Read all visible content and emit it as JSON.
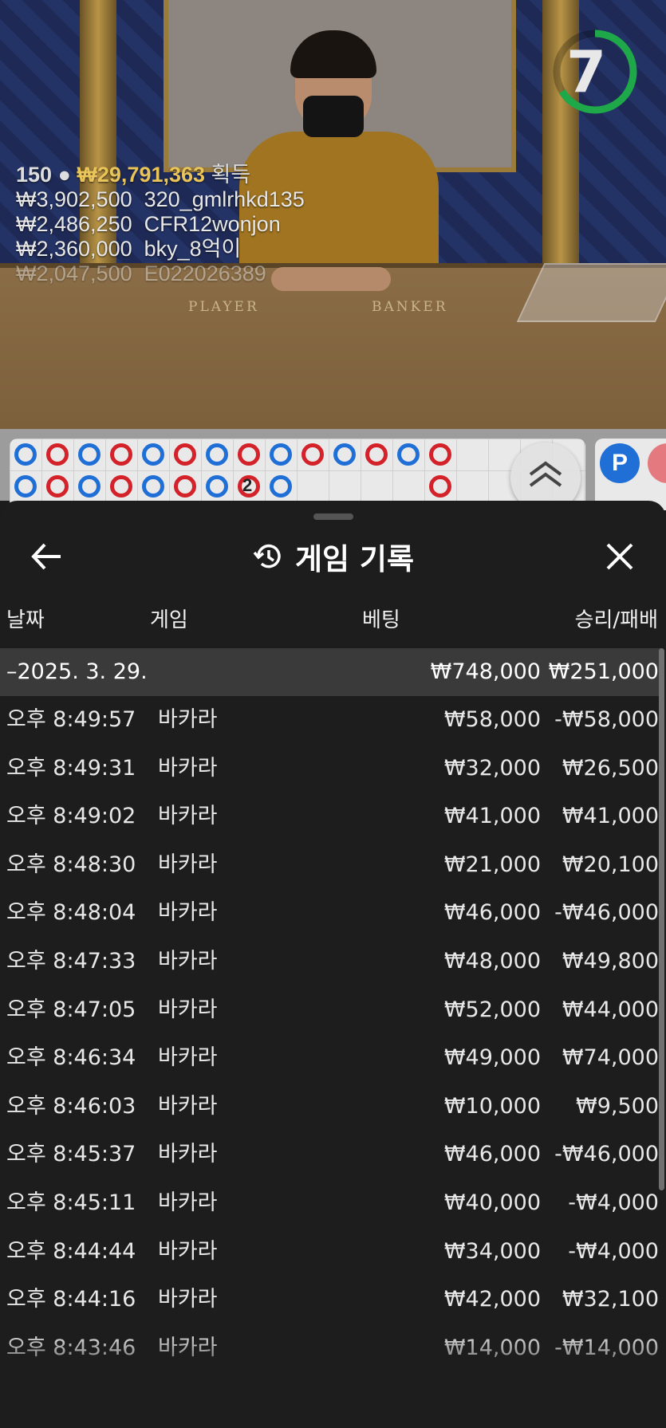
{
  "live_view": {
    "timer": "7",
    "timer_color": "#1fa84a",
    "felt_labels": [
      "PLAYER",
      "BANKER"
    ],
    "winners_total": {
      "count": "150",
      "amount": "₩29,791,363",
      "suffix": "획득"
    },
    "winners": [
      {
        "amount": "₩3,902,500",
        "user": "320_gmlrhkd135"
      },
      {
        "amount": "₩2,486,250",
        "user": "CFR12wonjon"
      },
      {
        "amount": "₩2,360,000",
        "user": "bky_8억이"
      },
      {
        "amount": "₩2,047,500",
        "user": "E022026389"
      }
    ]
  },
  "roadmap": {
    "top_row": [
      "P",
      "B",
      "P",
      "B",
      "P",
      "B",
      "P",
      "B",
      "P",
      "B",
      "P",
      "B",
      "P",
      "B"
    ],
    "bottom_row": [
      "P",
      "B",
      "P",
      "B",
      "P",
      "B",
      "P",
      "B",
      "P"
    ],
    "bottom_extra": "B",
    "tie_marker": "2",
    "player_bubble": "P",
    "collapse_icon": "double-chevron-up-icon"
  },
  "history": {
    "title": "게임 기록",
    "columns": {
      "date": "날짜",
      "game": "게임",
      "bet": "베팅",
      "result": "승리/패배"
    },
    "date_group": {
      "label": "–2025. 3. 29.",
      "bet": "₩748,000",
      "result": "₩251,000"
    },
    "rows": [
      {
        "time": "오후 8:49:57",
        "game": "바카라",
        "bet": "₩58,000",
        "result": "-₩58,000"
      },
      {
        "time": "오후 8:49:31",
        "game": "바카라",
        "bet": "₩32,000",
        "result": "₩26,500"
      },
      {
        "time": "오후 8:49:02",
        "game": "바카라",
        "bet": "₩41,000",
        "result": "₩41,000"
      },
      {
        "time": "오후 8:48:30",
        "game": "바카라",
        "bet": "₩21,000",
        "result": "₩20,100"
      },
      {
        "time": "오후 8:48:04",
        "game": "바카라",
        "bet": "₩46,000",
        "result": "-₩46,000"
      },
      {
        "time": "오후 8:47:33",
        "game": "바카라",
        "bet": "₩48,000",
        "result": "₩49,800"
      },
      {
        "time": "오후 8:47:05",
        "game": "바카라",
        "bet": "₩52,000",
        "result": "₩44,000"
      },
      {
        "time": "오후 8:46:34",
        "game": "바카라",
        "bet": "₩49,000",
        "result": "₩74,000"
      },
      {
        "time": "오후 8:46:03",
        "game": "바카라",
        "bet": "₩10,000",
        "result": "₩9,500"
      },
      {
        "time": "오후 8:45:37",
        "game": "바카라",
        "bet": "₩46,000",
        "result": "-₩46,000"
      },
      {
        "time": "오후 8:45:11",
        "game": "바카라",
        "bet": "₩40,000",
        "result": "-₩4,000"
      },
      {
        "time": "오후 8:44:44",
        "game": "바카라",
        "bet": "₩34,000",
        "result": "-₩4,000"
      },
      {
        "time": "오후 8:44:16",
        "game": "바카라",
        "bet": "₩42,000",
        "result": "₩32,100"
      },
      {
        "time": "오후 8:43:46",
        "game": "바카라",
        "bet": "₩14,000",
        "result": "-₩14,000"
      }
    ]
  }
}
